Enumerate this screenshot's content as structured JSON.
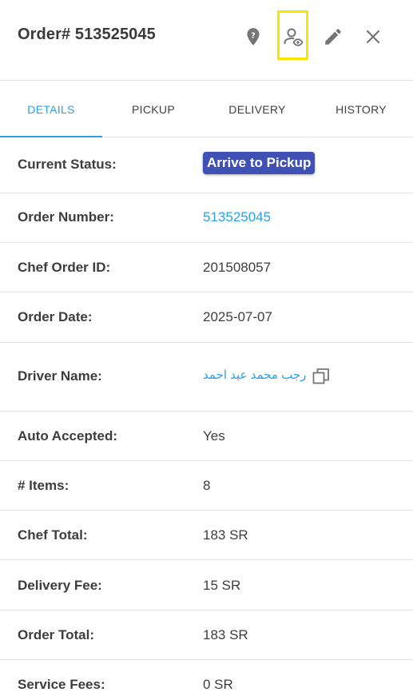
{
  "header": {
    "title": "Order# 513525045",
    "icons": [
      "help-icon",
      "view-user-icon",
      "edit-icon",
      "close-icon"
    ]
  },
  "tabs": [
    {
      "label": "DETAILS",
      "active": true
    },
    {
      "label": "PICKUP",
      "active": false
    },
    {
      "label": "DELIVERY",
      "active": false
    },
    {
      "label": "HISTORY",
      "active": false
    }
  ],
  "details": {
    "current_status": {
      "label": "Current Status:",
      "value": "Arrive to Pickup"
    },
    "order_number": {
      "label": "Order Number:",
      "value": "513525045"
    },
    "chef_order_id": {
      "label": "Chef Order ID:",
      "value": "201508057"
    },
    "order_date": {
      "label": "Order Date:",
      "value": "2025-07-07"
    },
    "driver_name": {
      "label": "Driver Name:",
      "value": "رجب محمد عيد احمد"
    },
    "auto_accepted": {
      "label": "Auto Accepted:",
      "value": "Yes"
    },
    "items": {
      "label": "# Items:",
      "value": "8"
    },
    "chef_total": {
      "label": "Chef Total:",
      "value": "183 SR"
    },
    "delivery_fee": {
      "label": "Delivery Fee:",
      "value": "15 SR"
    },
    "order_total": {
      "label": "Order Total:",
      "value": "183 SR"
    },
    "service_fees": {
      "label": "Service Fees:",
      "value": "0 SR"
    }
  },
  "colors": {
    "accent": "#2aa0e6",
    "status_chip": "#3f51b5",
    "highlight": "#f7e400",
    "icon": "#757575"
  }
}
